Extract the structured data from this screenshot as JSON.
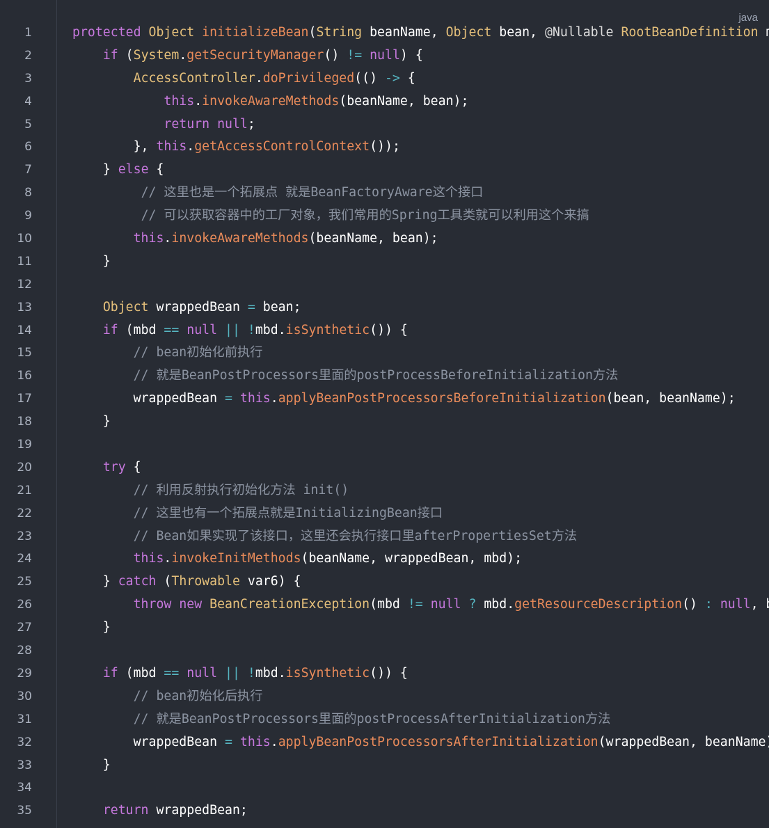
{
  "code_block": {
    "language": "java",
    "lines": [
      {
        "n": "1",
        "indent": "",
        "tokens": [
          {
            "t": "protected",
            "c": "kw"
          },
          {
            "t": " "
          },
          {
            "t": "Object",
            "c": "cls"
          },
          {
            "t": " "
          },
          {
            "t": "initializeBean",
            "c": "fn"
          },
          {
            "t": "("
          },
          {
            "t": "String",
            "c": "cls"
          },
          {
            "t": " beanName, "
          },
          {
            "t": "Object",
            "c": "cls"
          },
          {
            "t": " bean, "
          },
          {
            "t": "@Nullable",
            "c": "ann"
          },
          {
            "t": " "
          },
          {
            "t": "RootBeanDefinition",
            "c": "cls"
          },
          {
            "t": " mbd) {"
          }
        ]
      },
      {
        "n": "2",
        "indent": "    ",
        "tokens": [
          {
            "t": "if",
            "c": "kw"
          },
          {
            "t": " ("
          },
          {
            "t": "System",
            "c": "cls"
          },
          {
            "t": "."
          },
          {
            "t": "getSecurityManager",
            "c": "fn"
          },
          {
            "t": "() "
          },
          {
            "t": "!=",
            "c": "op"
          },
          {
            "t": " "
          },
          {
            "t": "null",
            "c": "kw"
          },
          {
            "t": ") {"
          }
        ]
      },
      {
        "n": "3",
        "indent": "        ",
        "tokens": [
          {
            "t": "AccessController",
            "c": "cls"
          },
          {
            "t": "."
          },
          {
            "t": "doPrivileged",
            "c": "fn"
          },
          {
            "t": "(() "
          },
          {
            "t": "->",
            "c": "op"
          },
          {
            "t": " {"
          }
        ]
      },
      {
        "n": "4",
        "indent": "            ",
        "tokens": [
          {
            "t": "this",
            "c": "kw"
          },
          {
            "t": "."
          },
          {
            "t": "invokeAwareMethods",
            "c": "fn"
          },
          {
            "t": "(beanName, bean);"
          }
        ]
      },
      {
        "n": "5",
        "indent": "            ",
        "tokens": [
          {
            "t": "return",
            "c": "kw"
          },
          {
            "t": " "
          },
          {
            "t": "null",
            "c": "kw"
          },
          {
            "t": ";"
          }
        ]
      },
      {
        "n": "6",
        "indent": "        ",
        "tokens": [
          {
            "t": "}, "
          },
          {
            "t": "this",
            "c": "kw"
          },
          {
            "t": "."
          },
          {
            "t": "getAccessControlContext",
            "c": "fn"
          },
          {
            "t": "());"
          }
        ]
      },
      {
        "n": "7",
        "indent": "    ",
        "tokens": [
          {
            "t": "} "
          },
          {
            "t": "else",
            "c": "kw"
          },
          {
            "t": " {"
          }
        ]
      },
      {
        "n": "8",
        "indent": "         ",
        "tokens": [
          {
            "t": "// 这里也是一个拓展点 就是BeanFactoryAware这个接口",
            "c": "cm"
          }
        ]
      },
      {
        "n": "9",
        "indent": "         ",
        "tokens": [
          {
            "t": "// 可以获取容器中的工厂对象，我们常用的Spring工具类就可以利用这个来搞",
            "c": "cm"
          }
        ]
      },
      {
        "n": "10",
        "indent": "        ",
        "tokens": [
          {
            "t": "this",
            "c": "kw"
          },
          {
            "t": "."
          },
          {
            "t": "invokeAwareMethods",
            "c": "fn"
          },
          {
            "t": "(beanName, bean);"
          }
        ]
      },
      {
        "n": "11",
        "indent": "    ",
        "tokens": [
          {
            "t": "}"
          }
        ]
      },
      {
        "n": "12",
        "indent": "",
        "tokens": []
      },
      {
        "n": "13",
        "indent": "    ",
        "tokens": [
          {
            "t": "Object",
            "c": "cls"
          },
          {
            "t": " wrappedBean "
          },
          {
            "t": "=",
            "c": "op"
          },
          {
            "t": " bean;"
          }
        ]
      },
      {
        "n": "14",
        "indent": "    ",
        "tokens": [
          {
            "t": "if",
            "c": "kw"
          },
          {
            "t": " (mbd "
          },
          {
            "t": "==",
            "c": "op"
          },
          {
            "t": " "
          },
          {
            "t": "null",
            "c": "kw"
          },
          {
            "t": " "
          },
          {
            "t": "||",
            "c": "op"
          },
          {
            "t": " "
          },
          {
            "t": "!",
            "c": "op"
          },
          {
            "t": "mbd."
          },
          {
            "t": "isSynthetic",
            "c": "fn"
          },
          {
            "t": "()) {"
          }
        ]
      },
      {
        "n": "15",
        "indent": "        ",
        "tokens": [
          {
            "t": "// bean初始化前执行",
            "c": "cm"
          }
        ]
      },
      {
        "n": "16",
        "indent": "        ",
        "tokens": [
          {
            "t": "// 就是BeanPostProcessors里面的postProcessBeforeInitialization方法",
            "c": "cm"
          }
        ]
      },
      {
        "n": "17",
        "indent": "        ",
        "tokens": [
          {
            "t": "wrappedBean "
          },
          {
            "t": "=",
            "c": "op"
          },
          {
            "t": " "
          },
          {
            "t": "this",
            "c": "kw"
          },
          {
            "t": "."
          },
          {
            "t": "applyBeanPostProcessorsBeforeInitialization",
            "c": "fn"
          },
          {
            "t": "(bean, beanName);"
          }
        ]
      },
      {
        "n": "18",
        "indent": "    ",
        "tokens": [
          {
            "t": "}"
          }
        ]
      },
      {
        "n": "19",
        "indent": "",
        "tokens": []
      },
      {
        "n": "20",
        "indent": "    ",
        "tokens": [
          {
            "t": "try",
            "c": "kw"
          },
          {
            "t": " {"
          }
        ]
      },
      {
        "n": "21",
        "indent": "        ",
        "tokens": [
          {
            "t": "// 利用反射执行初始化方法 init()",
            "c": "cm"
          }
        ]
      },
      {
        "n": "22",
        "indent": "        ",
        "tokens": [
          {
            "t": "// 这里也有一个拓展点就是InitializingBean接口",
            "c": "cm"
          }
        ]
      },
      {
        "n": "23",
        "indent": "        ",
        "tokens": [
          {
            "t": "// Bean如果实现了该接口，这里还会执行接口里afterPropertiesSet方法",
            "c": "cm"
          }
        ]
      },
      {
        "n": "24",
        "indent": "        ",
        "tokens": [
          {
            "t": "this",
            "c": "kw"
          },
          {
            "t": "."
          },
          {
            "t": "invokeInitMethods",
            "c": "fn"
          },
          {
            "t": "(beanName, wrappedBean, mbd);"
          }
        ]
      },
      {
        "n": "25",
        "indent": "    ",
        "tokens": [
          {
            "t": "} "
          },
          {
            "t": "catch",
            "c": "kw"
          },
          {
            "t": " ("
          },
          {
            "t": "Throwable",
            "c": "cls"
          },
          {
            "t": " var6) {"
          }
        ]
      },
      {
        "n": "26",
        "indent": "        ",
        "tokens": [
          {
            "t": "throw",
            "c": "kw"
          },
          {
            "t": " "
          },
          {
            "t": "new",
            "c": "kw"
          },
          {
            "t": " "
          },
          {
            "t": "BeanCreationException",
            "c": "cls"
          },
          {
            "t": "(mbd "
          },
          {
            "t": "!=",
            "c": "op"
          },
          {
            "t": " "
          },
          {
            "t": "null",
            "c": "kw"
          },
          {
            "t": " "
          },
          {
            "t": "?",
            "c": "op"
          },
          {
            "t": " mbd."
          },
          {
            "t": "getResourceDescription",
            "c": "fn"
          },
          {
            "t": "() "
          },
          {
            "t": ":",
            "c": "op"
          },
          {
            "t": " "
          },
          {
            "t": "null",
            "c": "kw"
          },
          {
            "t": ", beanName, "
          }
        ]
      },
      {
        "n": "27",
        "indent": "    ",
        "tokens": [
          {
            "t": "}"
          }
        ]
      },
      {
        "n": "28",
        "indent": "",
        "tokens": []
      },
      {
        "n": "29",
        "indent": "    ",
        "tokens": [
          {
            "t": "if",
            "c": "kw"
          },
          {
            "t": " (mbd "
          },
          {
            "t": "==",
            "c": "op"
          },
          {
            "t": " "
          },
          {
            "t": "null",
            "c": "kw"
          },
          {
            "t": " "
          },
          {
            "t": "||",
            "c": "op"
          },
          {
            "t": " "
          },
          {
            "t": "!",
            "c": "op"
          },
          {
            "t": "mbd."
          },
          {
            "t": "isSynthetic",
            "c": "fn"
          },
          {
            "t": "()) {"
          }
        ]
      },
      {
        "n": "30",
        "indent": "        ",
        "tokens": [
          {
            "t": "// bean初始化后执行",
            "c": "cm"
          }
        ]
      },
      {
        "n": "31",
        "indent": "        ",
        "tokens": [
          {
            "t": "// 就是BeanPostProcessors里面的postProcessAfterInitialization方法",
            "c": "cm"
          }
        ]
      },
      {
        "n": "32",
        "indent": "        ",
        "tokens": [
          {
            "t": "wrappedBean "
          },
          {
            "t": "=",
            "c": "op"
          },
          {
            "t": " "
          },
          {
            "t": "this",
            "c": "kw"
          },
          {
            "t": "."
          },
          {
            "t": "applyBeanPostProcessorsAfterInitialization",
            "c": "fn"
          },
          {
            "t": "(wrappedBean, beanName);"
          }
        ]
      },
      {
        "n": "33",
        "indent": "    ",
        "tokens": [
          {
            "t": "}"
          }
        ]
      },
      {
        "n": "34",
        "indent": "",
        "tokens": []
      },
      {
        "n": "35",
        "indent": "    ",
        "tokens": [
          {
            "t": "return",
            "c": "kw"
          },
          {
            "t": " wrappedBean;"
          }
        ]
      }
    ]
  },
  "colors": {
    "background": "#282c34",
    "keyword": "#c678dd",
    "class": "#e5c07b",
    "function": "#e98b5a",
    "operator": "#56b6c2",
    "comment": "#8b93a1",
    "plain": "#ffffff"
  }
}
